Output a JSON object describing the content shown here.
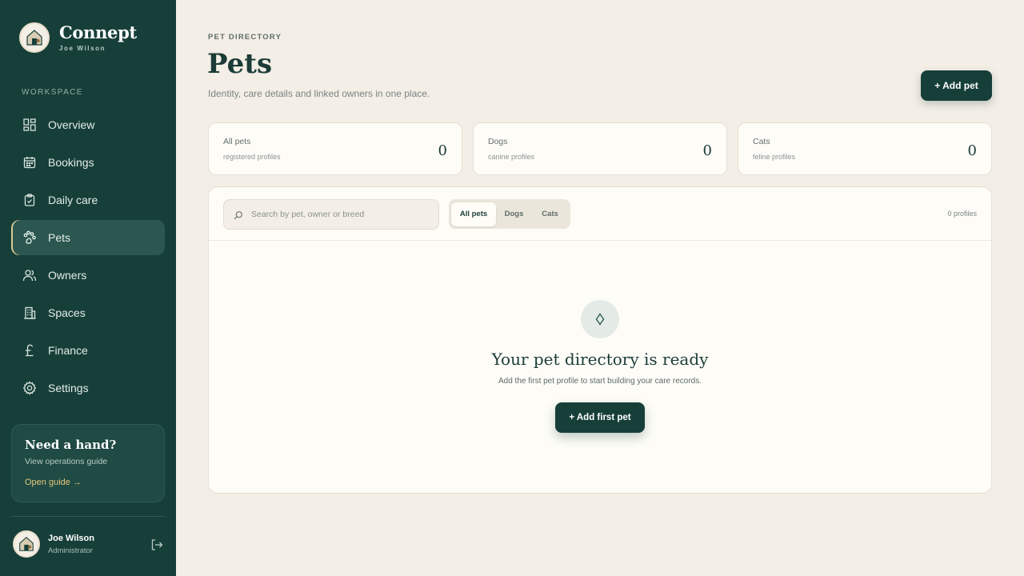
{
  "app": {
    "name": "Connept",
    "user_caption": "Joe Wilson"
  },
  "sidebar": {
    "section_label": "WORKSPACE",
    "items": [
      {
        "label": "Overview",
        "icon": "grid-icon"
      },
      {
        "label": "Bookings",
        "icon": "calendar-icon"
      },
      {
        "label": "Daily care",
        "icon": "clipboard-icon"
      },
      {
        "label": "Pets",
        "icon": "paw-icon",
        "active": true
      },
      {
        "label": "Owners",
        "icon": "users-icon"
      },
      {
        "label": "Spaces",
        "icon": "building-icon"
      },
      {
        "label": "Finance",
        "icon": "pound-icon"
      },
      {
        "label": "Settings",
        "icon": "gear-icon"
      }
    ],
    "help": {
      "title": "Need a hand?",
      "subtitle": "View operations guide",
      "link": "Open guide →"
    },
    "user": {
      "name": "Joe Wilson",
      "role": "Administrator"
    }
  },
  "header": {
    "eyebrow": "PET DIRECTORY",
    "title": "Pets",
    "subtitle": "Identity, care details and linked owners in one place.",
    "add_button": "+ Add pet"
  },
  "stats": [
    {
      "label": "All pets",
      "sub": "registered profiles",
      "value": "0"
    },
    {
      "label": "Dogs",
      "sub": "canine profiles",
      "value": "0"
    },
    {
      "label": "Cats",
      "sub": "feline profiles",
      "value": "0"
    }
  ],
  "panel": {
    "search_placeholder": "Search by pet, owner or breed",
    "tabs": [
      "All pets",
      "Dogs",
      "Cats"
    ],
    "active_tab": "All pets",
    "count": "0 profiles",
    "empty": {
      "title": "Your pet directory is ready",
      "subtitle": "Add the first pet profile to start building your care records.",
      "button": "+ Add first pet"
    }
  },
  "colors": {
    "sidebar": "#173f39",
    "accent": "#e5c57c",
    "background": "#f3eee6",
    "card": "#fdfcf7"
  }
}
